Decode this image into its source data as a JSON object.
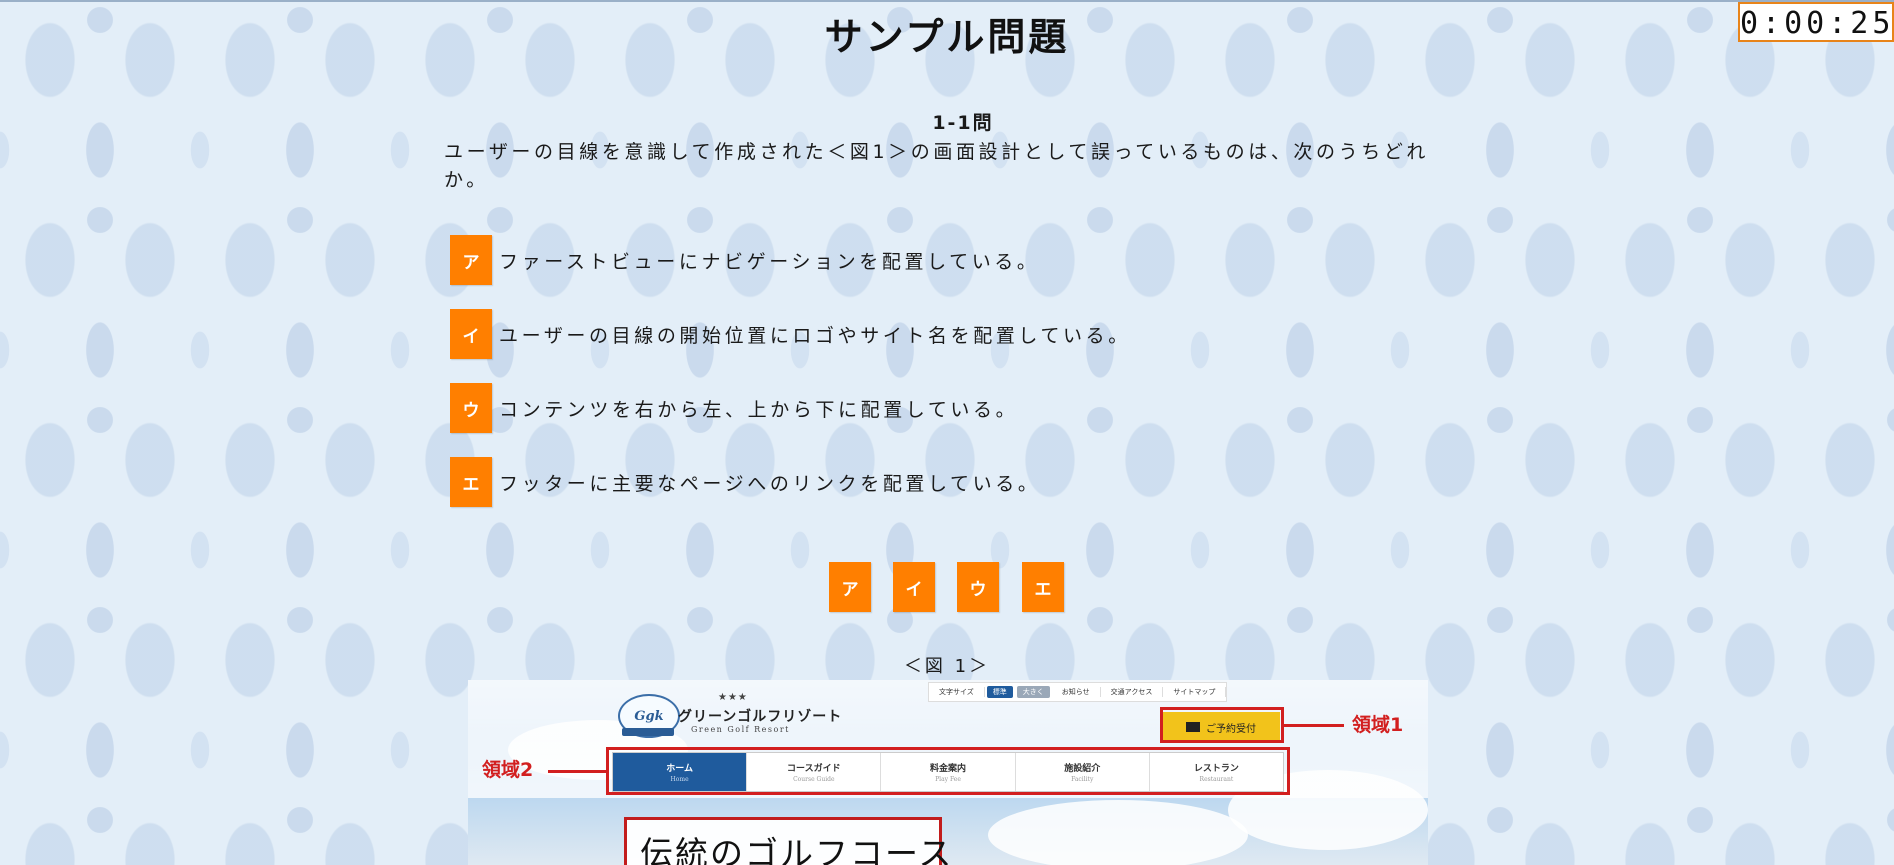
{
  "page": {
    "title": "サンプル問題",
    "timer": "0:00:25"
  },
  "question": {
    "number": "1-1問",
    "text": "ユーザーの目線を意識して作成された＜図1＞の画面設計として誤っているものは、次のうちどれか。"
  },
  "options": [
    {
      "key": "ア",
      "text": "ファーストビューにナビゲーションを配置している。"
    },
    {
      "key": "イ",
      "text": "ユーザーの目線の開始位置にロゴやサイト名を配置している。"
    },
    {
      "key": "ウ",
      "text": "コンテンツを右から左、上から下に配置している。"
    },
    {
      "key": "エ",
      "text": "フッターに主要なページへのリンクを配置している。"
    }
  ],
  "answer_buttons": [
    "ア",
    "イ",
    "ウ",
    "エ"
  ],
  "figure": {
    "caption": "＜図 1＞",
    "site": {
      "stars": "★★★",
      "name": "グリーンゴルフリゾート",
      "subtitle": "Green Golf Resort",
      "logo_text": "Ggk"
    },
    "utility_nav": {
      "font_size_label": "文字サイズ",
      "standard": "標準",
      "large": "大きく",
      "links": [
        "お知らせ",
        "交通アクセス",
        "サイトマップ"
      ]
    },
    "reserve_button": "ご予約受付",
    "nav": [
      {
        "label": "ホーム",
        "sub": "Home"
      },
      {
        "label": "コースガイド",
        "sub": "Course Guide"
      },
      {
        "label": "料金案内",
        "sub": "Play Fee"
      },
      {
        "label": "施設紹介",
        "sub": "Facility"
      },
      {
        "label": "レストラン",
        "sub": "Restaurant"
      }
    ],
    "annotations": {
      "area1": "領域1",
      "area2": "領域2"
    },
    "hero_text": "伝統のゴルフコース"
  },
  "colors": {
    "accent": "#ff7f00",
    "annotation": "#d21f1f",
    "nav_active": "#1f5b9d",
    "reserve": "#f2c31b",
    "background": "#e3eef8"
  }
}
